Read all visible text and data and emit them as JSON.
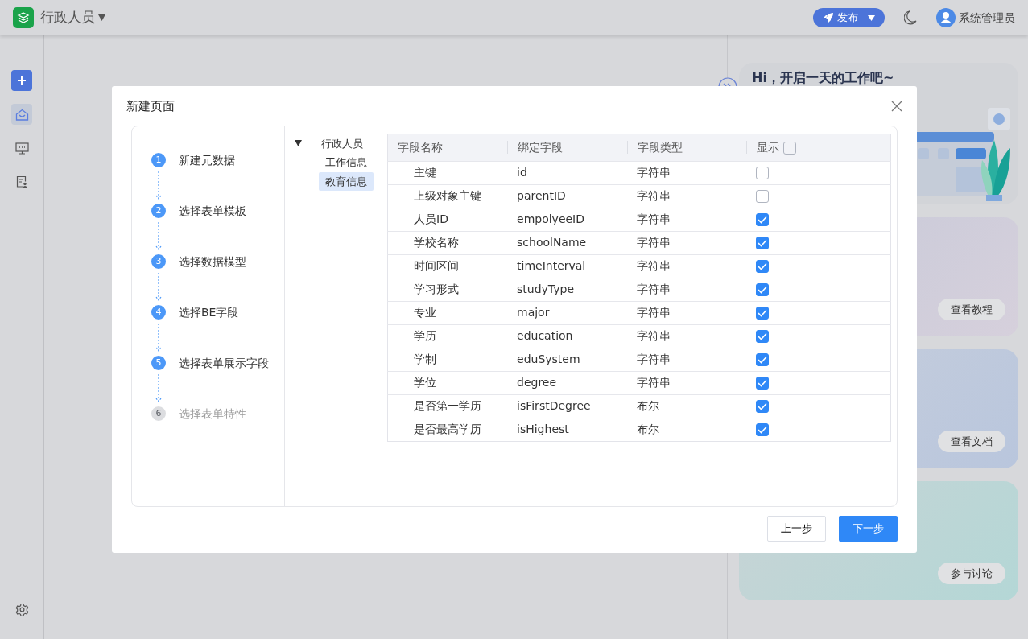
{
  "header": {
    "app_title": "行政人员",
    "publish_button": "发布",
    "user_name": "系统管理员"
  },
  "sidebar": {
    "items": [
      {
        "kind": "add",
        "selected": false
      },
      {
        "kind": "home",
        "selected": true
      },
      {
        "kind": "monitor",
        "selected": false
      },
      {
        "kind": "form",
        "selected": false
      },
      {
        "kind": "settings",
        "selected": false
      }
    ]
  },
  "welcome": {
    "greeting": "Hi，开启一天的工作吧~",
    "buttons": [
      "查看教程",
      "查看文档",
      "参与讨论"
    ]
  },
  "dialog": {
    "title": "新建页面",
    "steps": [
      {
        "number": "1",
        "label": "新建元数据",
        "done": true
      },
      {
        "number": "2",
        "label": "选择表单模板",
        "done": true
      },
      {
        "number": "3",
        "label": "选择数据模型",
        "done": true
      },
      {
        "number": "4",
        "label": "选择BE字段",
        "done": true
      },
      {
        "number": "5",
        "label": "选择表单展示字段",
        "done": true
      },
      {
        "number": "6",
        "label": "选择表单特性",
        "done": false
      }
    ],
    "tree": [
      {
        "label": "行政人员",
        "expanded": true,
        "selected": false,
        "children": [
          {
            "label": "工作信息",
            "selected": false
          },
          {
            "label": "教育信息",
            "selected": true
          }
        ]
      }
    ],
    "table": {
      "columns": [
        "字段名称",
        "绑定字段",
        "字段类型",
        "显示"
      ],
      "header_checked": false,
      "rows": [
        {
          "name": "主键",
          "field": "id",
          "type": "字符串",
          "checked": false
        },
        {
          "name": "上级对象主键",
          "field": "parentID",
          "type": "字符串",
          "checked": false
        },
        {
          "name": "人员ID",
          "field": "empolyeeID",
          "type": "字符串",
          "checked": true
        },
        {
          "name": "学校名称",
          "field": "schoolName",
          "type": "字符串",
          "checked": true
        },
        {
          "name": "时间区间",
          "field": "timeInterval",
          "type": "字符串",
          "checked": true
        },
        {
          "name": "学习形式",
          "field": "studyType",
          "type": "字符串",
          "checked": true
        },
        {
          "name": "专业",
          "field": "major",
          "type": "字符串",
          "checked": true
        },
        {
          "name": "学历",
          "field": "education",
          "type": "字符串",
          "checked": true
        },
        {
          "name": "学制",
          "field": "eduSystem",
          "type": "字符串",
          "checked": true
        },
        {
          "name": "学位",
          "field": "degree",
          "type": "字符串",
          "checked": true
        },
        {
          "name": "是否第一学历",
          "field": "isFirstDegree",
          "type": "布尔",
          "checked": true
        },
        {
          "name": "是否最高学历",
          "field": "isHighest",
          "type": "布尔",
          "checked": true
        }
      ]
    },
    "buttons": {
      "prev": "上一步",
      "next": "下一步"
    }
  }
}
